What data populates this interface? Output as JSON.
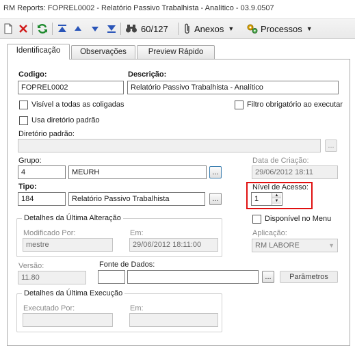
{
  "window": {
    "title": "RM Reports: FOPREL0002 - Relatório Passivo Trabalhista - Analítico - 03.9.0507"
  },
  "toolbar": {
    "record_counter": "60/127",
    "anexos_label": "Anexos",
    "processos_label": "Processos"
  },
  "tabs": [
    {
      "label": "Identificação"
    },
    {
      "label": "Observações"
    },
    {
      "label": "Preview Rápido"
    }
  ],
  "form": {
    "codigo_label": "Codigo:",
    "codigo_value": "FOPREL0002",
    "descricao_label": "Descrição:",
    "descricao_value": "Relatório Passivo Trabalhista - Analítico",
    "visivel_label": "Visível a todas as coligadas",
    "filtro_label": "Filtro obrigatório ao executar",
    "usa_dir_label": "Usa diretório padrão",
    "diretorio_label": "Diretório padrão:",
    "browse_label": "...",
    "grupo_label": "Grupo:",
    "grupo_code": "4",
    "grupo_name": "MEURH",
    "data_criacao_label": "Data de Criação:",
    "data_criacao_value": "29/06/2012 18:11",
    "tipo_label": "Tipo:",
    "tipo_code": "184",
    "tipo_name": "Relatório Passivo Trabalhista",
    "nivel_label": "Nível de Acesso:",
    "nivel_value": "1",
    "ultima_alteracao_title": "Detalhes da Última Alteração",
    "modificado_label": "Modificado Por:",
    "modificado_value": "mestre",
    "em_label": "Em:",
    "em_value": "29/06/2012 18:11:00",
    "disponivel_label": "Disponível no Menu",
    "aplicacao_label": "Aplicação:",
    "aplicacao_value": "RM LABORE",
    "versao_label": "Versão:",
    "versao_value": "11.80",
    "fonte_label": "Fonte de Dados:",
    "parametros_label": "Parâmetros",
    "ultima_execucao_title": "Detalhes da Última Execução",
    "executado_label": "Executado Por:",
    "em2_label": "Em:"
  },
  "colors": {
    "highlight": "#e01010",
    "accent": "#2a6fb8"
  },
  "icons": [
    "new-icon",
    "delete-icon",
    "refresh-icon",
    "first-icon",
    "previous-icon",
    "next-icon",
    "last-icon",
    "binoculars-icon",
    "paperclip-icon",
    "gears-icon"
  ]
}
